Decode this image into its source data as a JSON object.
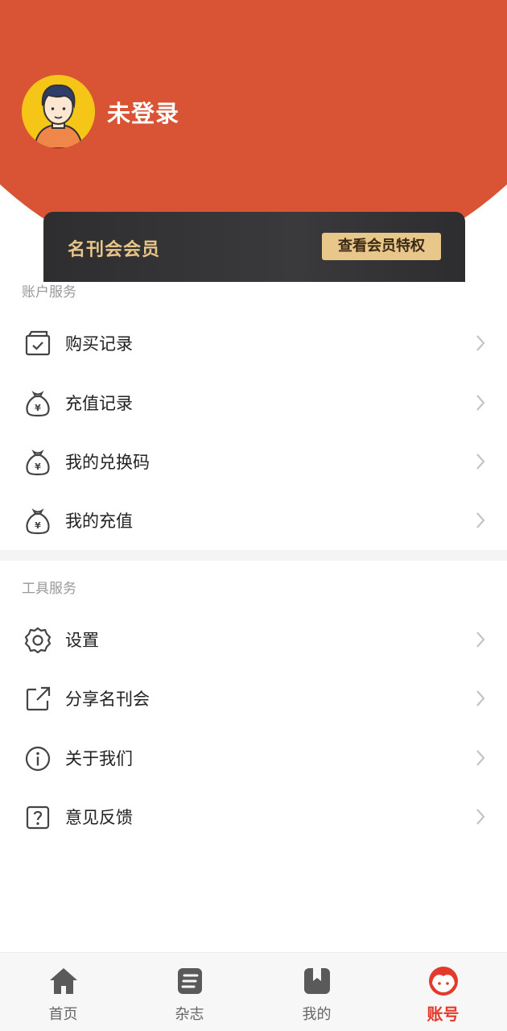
{
  "header": {
    "username": "未登录",
    "vip_title": "名刊会会员",
    "vip_button": "查看会员特权"
  },
  "account_section": {
    "title": "账户服务",
    "items": [
      {
        "label": "购买记录",
        "icon": "purchase-record-icon"
      },
      {
        "label": "充值记录",
        "icon": "money-bag-icon"
      },
      {
        "label": "我的兑换码",
        "icon": "money-bag-icon"
      },
      {
        "label": "我的充值",
        "icon": "money-bag-icon"
      }
    ]
  },
  "tools_section": {
    "title": "工具服务",
    "items": [
      {
        "label": "设置",
        "icon": "gear-icon"
      },
      {
        "label": "分享名刊会",
        "icon": "share-icon"
      },
      {
        "label": "关于我们",
        "icon": "info-icon"
      },
      {
        "label": "意见反馈",
        "icon": "feedback-icon"
      }
    ]
  },
  "tabbar": {
    "tabs": [
      {
        "label": "首页",
        "icon": "home-icon"
      },
      {
        "label": "杂志",
        "icon": "magazine-icon"
      },
      {
        "label": "我的",
        "icon": "bookmark-book-icon"
      },
      {
        "label": "账号",
        "icon": "account-face-icon"
      }
    ],
    "active_index": 3
  },
  "colors": {
    "header_red": "#d85435",
    "vip_gold": "#e9c689",
    "active_tab": "#e23a2c"
  }
}
